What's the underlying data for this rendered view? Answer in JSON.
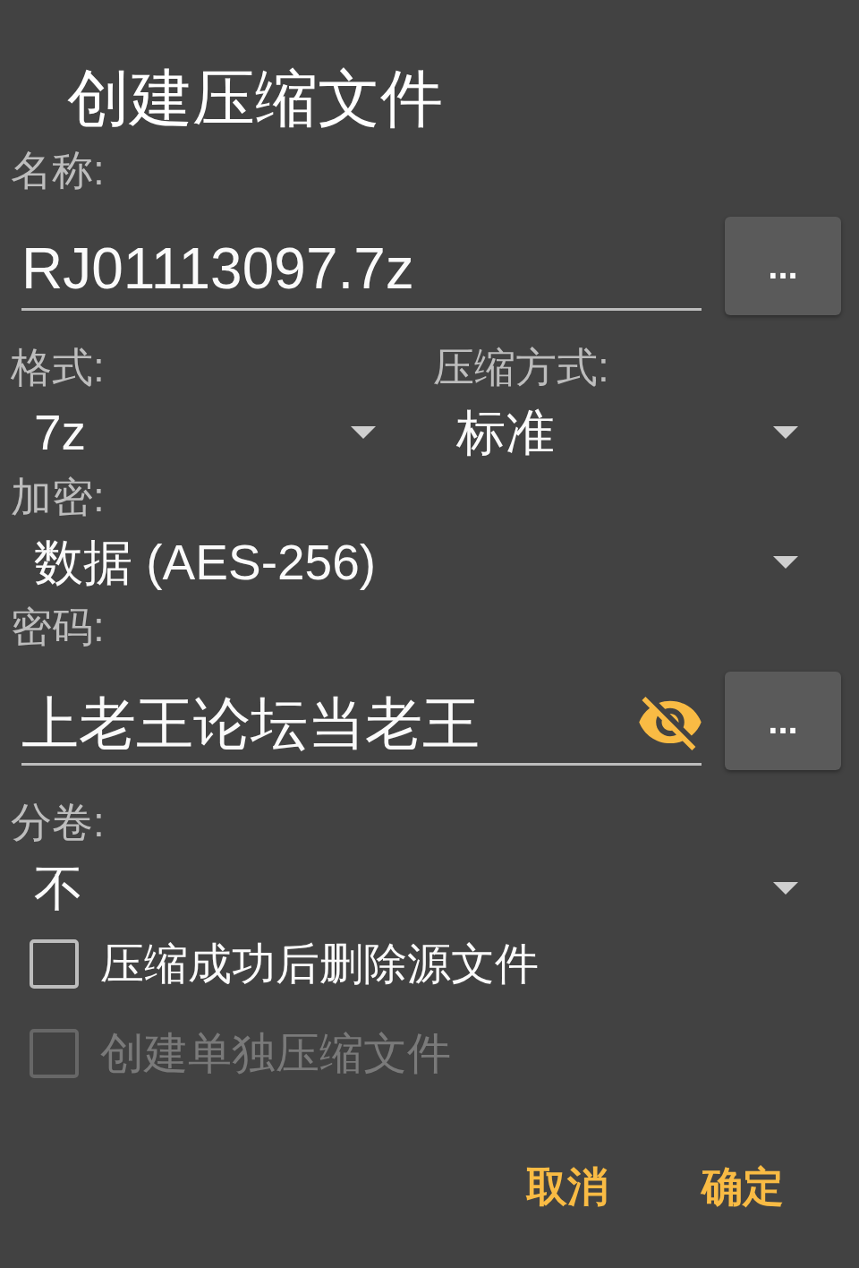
{
  "dialog": {
    "title": "创建压缩文件"
  },
  "name": {
    "label": "名称:",
    "value": "RJ01113097.7z",
    "button": "..."
  },
  "format": {
    "label": "格式:",
    "value": "7z"
  },
  "method": {
    "label": "压缩方式:",
    "value": "标准"
  },
  "encryption": {
    "label": "加密:",
    "value": "数据 (AES-256)"
  },
  "password": {
    "label": "密码:",
    "value": "上老王论坛当老王",
    "shown": true,
    "button": "..."
  },
  "volumes": {
    "label": "分卷:",
    "value": "不"
  },
  "options": [
    {
      "label": "压缩成功后删除源文件",
      "checked": false,
      "disabled": false
    },
    {
      "label": "创建单独压缩文件",
      "checked": false,
      "disabled": true
    }
  ],
  "buttons": [
    {
      "label": "取消"
    },
    {
      "label": "确定"
    }
  ]
}
